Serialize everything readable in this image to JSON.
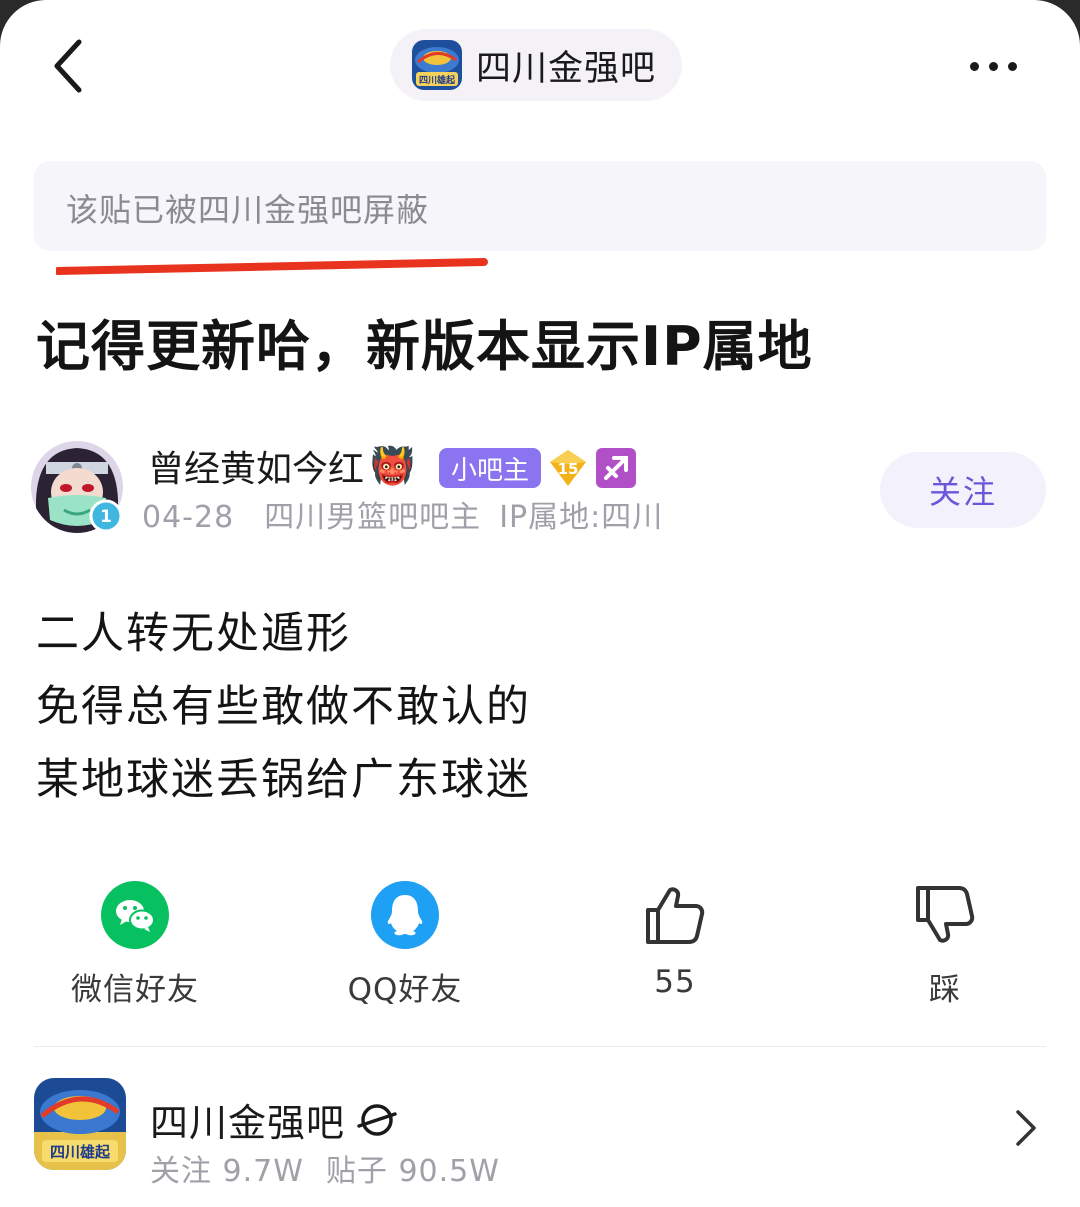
{
  "header": {
    "back_icon": "chevron-left-icon",
    "forum_name": "四川金强吧",
    "forum_logo_text": "四川雄起",
    "more_icon": "more-horizontal-icon"
  },
  "notice": {
    "text": "该贴已被四川金强吧屏蔽",
    "underline_color": "#e8331f"
  },
  "post": {
    "title": "记得更新哈，新版本显示IP属地",
    "author": {
      "name": "曾经黄如今红",
      "name_emoji": "👹",
      "badge_moderator": "小吧主",
      "level": "15",
      "avatar_level": "1",
      "date": "04-28",
      "role": "四川男篮吧吧主",
      "ip_location": "IP属地:四川",
      "follow_label": "关注"
    },
    "content_lines": [
      "二人转无处遁形",
      "免得总有些敢做不敢认的",
      "某地球迷丢锅给广东球迷"
    ]
  },
  "actions": [
    {
      "icon": "wechat-icon",
      "label": "微信好友",
      "color": "#07c160"
    },
    {
      "icon": "qq-icon",
      "label": "QQ好友",
      "color": "#1ea0f4"
    },
    {
      "icon": "thumbs-up-icon",
      "label": "55"
    },
    {
      "icon": "thumbs-down-icon",
      "label": "踩"
    }
  ],
  "forum_card": {
    "name": "四川金强吧",
    "logo_text": "四川雄起",
    "followers": "关注 9.7W",
    "posts": "贴子 90.5W",
    "chevron_icon": "chevron-right-icon"
  },
  "colors": {
    "accent": "#6b56d8",
    "moderator_badge": "#8a74f0",
    "level_badge": "#f4b21a",
    "sagittarius_badge": "#b14fc7"
  }
}
